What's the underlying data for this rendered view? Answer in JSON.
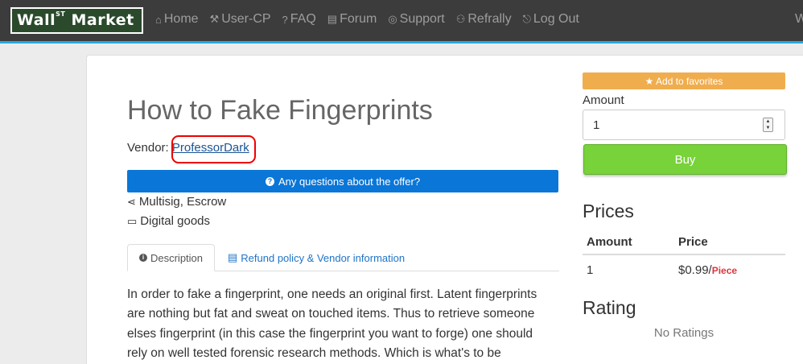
{
  "brand": {
    "name_main": "Wall",
    "name_sup": "ST",
    "name_rest": " Market"
  },
  "nav": [
    {
      "label": "Home",
      "icon": "⌂",
      "icon_name": "home-icon"
    },
    {
      "label": "User-CP",
      "icon": "⚒",
      "icon_name": "tools-icon"
    },
    {
      "label": "FAQ",
      "icon": "?",
      "icon_name": "question-icon"
    },
    {
      "label": "Forum",
      "icon": "▤",
      "icon_name": "forum-icon"
    },
    {
      "label": "Support",
      "icon": "◎",
      "icon_name": "lifebuoy-icon"
    },
    {
      "label": "Refrally",
      "icon": "⚇",
      "icon_name": "users-icon"
    },
    {
      "label": "Log Out",
      "icon": "⎋",
      "icon_name": "logout-icon"
    }
  ],
  "nav_overflow": "W",
  "product": {
    "title": "How to Fake Fingerprints",
    "vendor_label": "Vendor: ",
    "vendor_name": "ProfessorDark",
    "questions_button": "Any questions about the offer?",
    "features": [
      {
        "icon": "⋖",
        "icon_name": "share-icon",
        "label": "Multisig, Escrow"
      },
      {
        "icon": "▭",
        "icon_name": "monitor-icon",
        "label": "Digital goods"
      }
    ]
  },
  "tabs": [
    {
      "label": "Description",
      "icon_name": "info-icon"
    },
    {
      "label": "Refund policy & Vendor information",
      "icon_name": "clipboard-icon"
    }
  ],
  "description": "In order to fake a fingerprint, one needs an original first. Latent fingerprints are nothing but fat and sweat on touched items. Thus to retrieve someone elses fingerprint (in this case the fingerprint you want to forge) one should rely on well tested forensic research methods. Which is what's to be",
  "sidebar": {
    "favorites_button": "★ Add to favorites",
    "amount_label": "Amount",
    "amount_value": "1",
    "buy_button": "Buy",
    "prices_heading": "Prices",
    "prices_columns": [
      "Amount",
      "Price"
    ],
    "prices_rows": [
      {
        "amount": "1",
        "price": "$0.99/",
        "unit": "Piece"
      }
    ],
    "rating_heading": "Rating",
    "no_ratings": "No Ratings"
  },
  "colors": {
    "navbar": "#3c3c3c",
    "accent_line": "#29a8e0",
    "primary": "#0a76d8",
    "favorites": "#f0ad4e",
    "buy": "#78d23a",
    "price_unit": "#d9363e",
    "annotation": "#ee0000"
  }
}
